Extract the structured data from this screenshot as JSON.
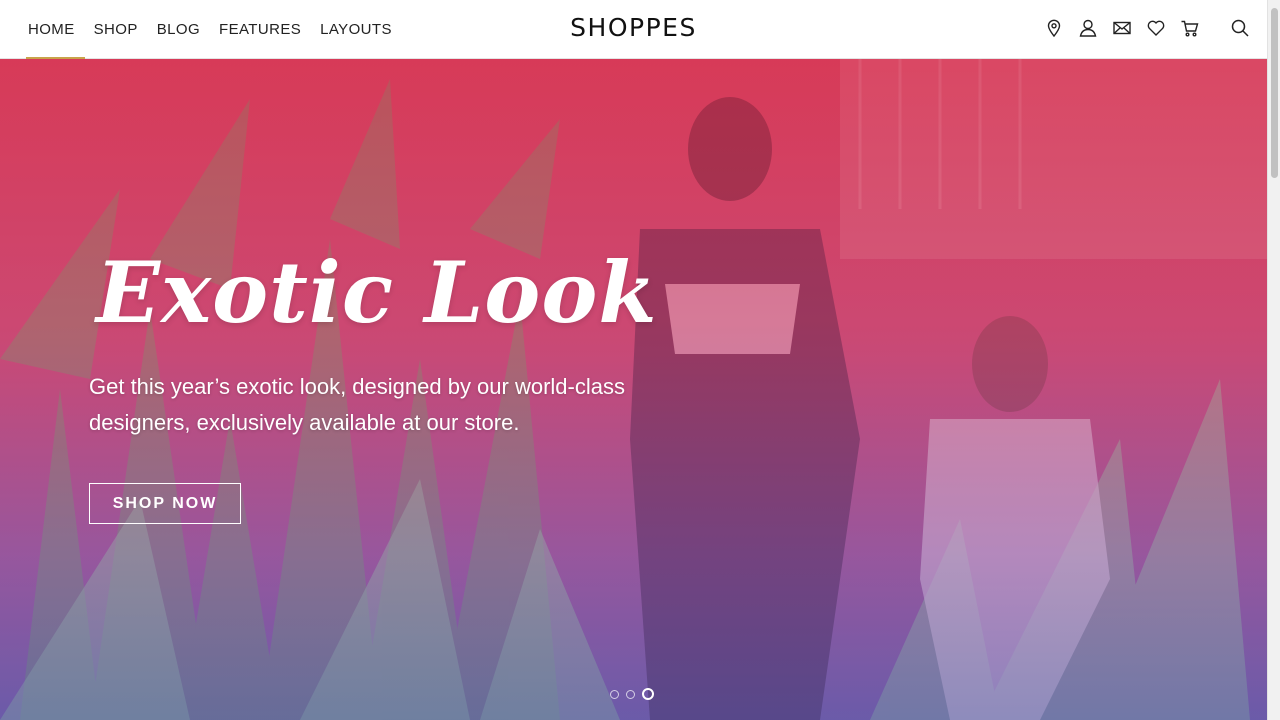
{
  "header": {
    "nav": [
      {
        "label": "HOME",
        "active": true
      },
      {
        "label": "SHOP",
        "active": false
      },
      {
        "label": "BLOG",
        "active": false
      },
      {
        "label": "FEATURES",
        "active": false
      },
      {
        "label": "LAYOUTS",
        "active": false
      }
    ],
    "logo": "SHOPPES",
    "icons": [
      "location-pin-icon",
      "user-icon",
      "mail-icon",
      "heart-icon",
      "cart-icon",
      "search-icon"
    ],
    "accent_color": "#c9a34a"
  },
  "hero": {
    "title": "Exotic Look",
    "subtitle": "Get this year’s exotic look, designed by our world-class designers, exclusively available at our store.",
    "cta_label": "SHOP NOW",
    "slides_count": 3,
    "active_slide": 3,
    "gradient_colors": [
      "#d62f54",
      "#5a5aaa"
    ]
  }
}
